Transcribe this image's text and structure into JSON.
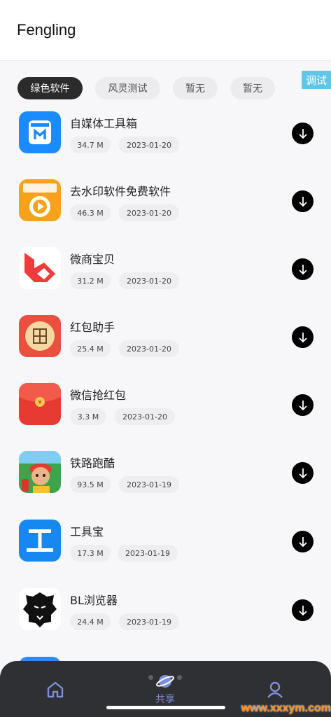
{
  "header": {
    "title": "Fengling"
  },
  "tabs": [
    {
      "label": "绿色软件",
      "active": true
    },
    {
      "label": "风灵测试",
      "active": false
    },
    {
      "label": "暂无",
      "active": false
    },
    {
      "label": "暂无",
      "active": false
    }
  ],
  "debug_badge": "调试",
  "apps": [
    {
      "name": "自媒体工具箱",
      "size": "34.7 M",
      "date": "2023-01-20",
      "icon": "toolbox-icon"
    },
    {
      "name": "去水印软件免费软件",
      "size": "46.3 M",
      "date": "2023-01-20",
      "icon": "watermark-remover-icon"
    },
    {
      "name": "微商宝贝",
      "size": "31.2 M",
      "date": "2023-01-20",
      "icon": "wechat-business-icon"
    },
    {
      "name": "红包助手",
      "size": "25.4 M",
      "date": "2023-01-20",
      "icon": "red-packet-helper-icon"
    },
    {
      "name": "微信抢红包",
      "size": "3.3 M",
      "date": "2023-01-20",
      "icon": "red-envelope-icon"
    },
    {
      "name": "铁路跑酷",
      "size": "93.5 M",
      "date": "2023-01-19",
      "icon": "subway-surfer-icon"
    },
    {
      "name": "工具宝",
      "size": "17.3 M",
      "date": "2023-01-19",
      "icon": "tool-treasure-icon"
    },
    {
      "name": "BL浏览器",
      "size": "24.4 M",
      "date": "2023-01-19",
      "icon": "lion-browser-icon"
    }
  ],
  "nav": {
    "home_icon": "home-icon",
    "share_label": "共享",
    "share_icon": "share-planet-icon",
    "profile_icon": "user-icon"
  },
  "watermark": "www.xxxym.com",
  "colors": {
    "accent": "#7c8fd8",
    "active_tab": "#2b2b2b",
    "badge": "#5ec6e7",
    "nav_bg": "#2f3033"
  }
}
